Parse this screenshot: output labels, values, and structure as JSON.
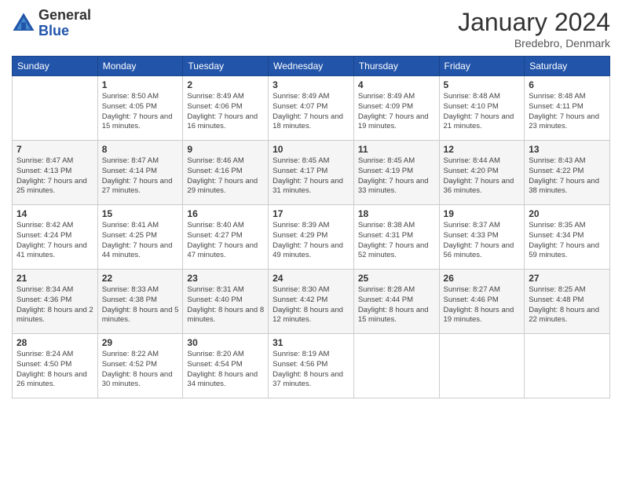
{
  "header": {
    "logo_general": "General",
    "logo_blue": "Blue",
    "month_title": "January 2024",
    "location": "Bredebro, Denmark"
  },
  "days_of_week": [
    "Sunday",
    "Monday",
    "Tuesday",
    "Wednesday",
    "Thursday",
    "Friday",
    "Saturday"
  ],
  "weeks": [
    [
      {
        "day": "",
        "sunrise": "",
        "sunset": "",
        "daylight": ""
      },
      {
        "day": "1",
        "sunrise": "Sunrise: 8:50 AM",
        "sunset": "Sunset: 4:05 PM",
        "daylight": "Daylight: 7 hours and 15 minutes."
      },
      {
        "day": "2",
        "sunrise": "Sunrise: 8:49 AM",
        "sunset": "Sunset: 4:06 PM",
        "daylight": "Daylight: 7 hours and 16 minutes."
      },
      {
        "day": "3",
        "sunrise": "Sunrise: 8:49 AM",
        "sunset": "Sunset: 4:07 PM",
        "daylight": "Daylight: 7 hours and 18 minutes."
      },
      {
        "day": "4",
        "sunrise": "Sunrise: 8:49 AM",
        "sunset": "Sunset: 4:09 PM",
        "daylight": "Daylight: 7 hours and 19 minutes."
      },
      {
        "day": "5",
        "sunrise": "Sunrise: 8:48 AM",
        "sunset": "Sunset: 4:10 PM",
        "daylight": "Daylight: 7 hours and 21 minutes."
      },
      {
        "day": "6",
        "sunrise": "Sunrise: 8:48 AM",
        "sunset": "Sunset: 4:11 PM",
        "daylight": "Daylight: 7 hours and 23 minutes."
      }
    ],
    [
      {
        "day": "7",
        "sunrise": "Sunrise: 8:47 AM",
        "sunset": "Sunset: 4:13 PM",
        "daylight": "Daylight: 7 hours and 25 minutes."
      },
      {
        "day": "8",
        "sunrise": "Sunrise: 8:47 AM",
        "sunset": "Sunset: 4:14 PM",
        "daylight": "Daylight: 7 hours and 27 minutes."
      },
      {
        "day": "9",
        "sunrise": "Sunrise: 8:46 AM",
        "sunset": "Sunset: 4:16 PM",
        "daylight": "Daylight: 7 hours and 29 minutes."
      },
      {
        "day": "10",
        "sunrise": "Sunrise: 8:45 AM",
        "sunset": "Sunset: 4:17 PM",
        "daylight": "Daylight: 7 hours and 31 minutes."
      },
      {
        "day": "11",
        "sunrise": "Sunrise: 8:45 AM",
        "sunset": "Sunset: 4:19 PM",
        "daylight": "Daylight: 7 hours and 33 minutes."
      },
      {
        "day": "12",
        "sunrise": "Sunrise: 8:44 AM",
        "sunset": "Sunset: 4:20 PM",
        "daylight": "Daylight: 7 hours and 36 minutes."
      },
      {
        "day": "13",
        "sunrise": "Sunrise: 8:43 AM",
        "sunset": "Sunset: 4:22 PM",
        "daylight": "Daylight: 7 hours and 38 minutes."
      }
    ],
    [
      {
        "day": "14",
        "sunrise": "Sunrise: 8:42 AM",
        "sunset": "Sunset: 4:24 PM",
        "daylight": "Daylight: 7 hours and 41 minutes."
      },
      {
        "day": "15",
        "sunrise": "Sunrise: 8:41 AM",
        "sunset": "Sunset: 4:25 PM",
        "daylight": "Daylight: 7 hours and 44 minutes."
      },
      {
        "day": "16",
        "sunrise": "Sunrise: 8:40 AM",
        "sunset": "Sunset: 4:27 PM",
        "daylight": "Daylight: 7 hours and 47 minutes."
      },
      {
        "day": "17",
        "sunrise": "Sunrise: 8:39 AM",
        "sunset": "Sunset: 4:29 PM",
        "daylight": "Daylight: 7 hours and 49 minutes."
      },
      {
        "day": "18",
        "sunrise": "Sunrise: 8:38 AM",
        "sunset": "Sunset: 4:31 PM",
        "daylight": "Daylight: 7 hours and 52 minutes."
      },
      {
        "day": "19",
        "sunrise": "Sunrise: 8:37 AM",
        "sunset": "Sunset: 4:33 PM",
        "daylight": "Daylight: 7 hours and 56 minutes."
      },
      {
        "day": "20",
        "sunrise": "Sunrise: 8:35 AM",
        "sunset": "Sunset: 4:34 PM",
        "daylight": "Daylight: 7 hours and 59 minutes."
      }
    ],
    [
      {
        "day": "21",
        "sunrise": "Sunrise: 8:34 AM",
        "sunset": "Sunset: 4:36 PM",
        "daylight": "Daylight: 8 hours and 2 minutes."
      },
      {
        "day": "22",
        "sunrise": "Sunrise: 8:33 AM",
        "sunset": "Sunset: 4:38 PM",
        "daylight": "Daylight: 8 hours and 5 minutes."
      },
      {
        "day": "23",
        "sunrise": "Sunrise: 8:31 AM",
        "sunset": "Sunset: 4:40 PM",
        "daylight": "Daylight: 8 hours and 8 minutes."
      },
      {
        "day": "24",
        "sunrise": "Sunrise: 8:30 AM",
        "sunset": "Sunset: 4:42 PM",
        "daylight": "Daylight: 8 hours and 12 minutes."
      },
      {
        "day": "25",
        "sunrise": "Sunrise: 8:28 AM",
        "sunset": "Sunset: 4:44 PM",
        "daylight": "Daylight: 8 hours and 15 minutes."
      },
      {
        "day": "26",
        "sunrise": "Sunrise: 8:27 AM",
        "sunset": "Sunset: 4:46 PM",
        "daylight": "Daylight: 8 hours and 19 minutes."
      },
      {
        "day": "27",
        "sunrise": "Sunrise: 8:25 AM",
        "sunset": "Sunset: 4:48 PM",
        "daylight": "Daylight: 8 hours and 22 minutes."
      }
    ],
    [
      {
        "day": "28",
        "sunrise": "Sunrise: 8:24 AM",
        "sunset": "Sunset: 4:50 PM",
        "daylight": "Daylight: 8 hours and 26 minutes."
      },
      {
        "day": "29",
        "sunrise": "Sunrise: 8:22 AM",
        "sunset": "Sunset: 4:52 PM",
        "daylight": "Daylight: 8 hours and 30 minutes."
      },
      {
        "day": "30",
        "sunrise": "Sunrise: 8:20 AM",
        "sunset": "Sunset: 4:54 PM",
        "daylight": "Daylight: 8 hours and 34 minutes."
      },
      {
        "day": "31",
        "sunrise": "Sunrise: 8:19 AM",
        "sunset": "Sunset: 4:56 PM",
        "daylight": "Daylight: 8 hours and 37 minutes."
      },
      {
        "day": "",
        "sunrise": "",
        "sunset": "",
        "daylight": ""
      },
      {
        "day": "",
        "sunrise": "",
        "sunset": "",
        "daylight": ""
      },
      {
        "day": "",
        "sunrise": "",
        "sunset": "",
        "daylight": ""
      }
    ]
  ]
}
